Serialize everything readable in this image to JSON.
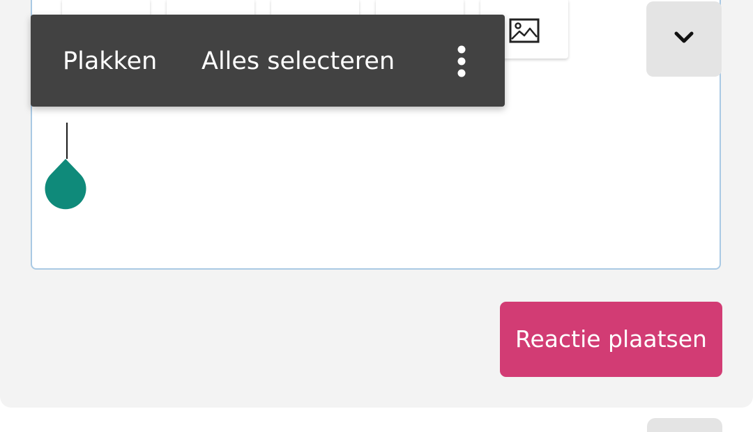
{
  "context_menu": {
    "paste": "Plakken",
    "select_all": "Alles selecteren"
  },
  "submit": {
    "label": "Reactie plaatsen"
  },
  "toolbar": {
    "icons": [
      "toolbar-button",
      "toolbar-button",
      "toolbar-button",
      "toolbar-button",
      "image-icon"
    ],
    "expand_icon": "chevron-down-icon"
  },
  "colors": {
    "card_background": "#f3f3f3",
    "editor_border": "#a9c9e4",
    "menu_background": "#424242",
    "handle": "#0f8a7a",
    "submit_background": "#d23c74",
    "expand_background": "#e4e4e4"
  }
}
